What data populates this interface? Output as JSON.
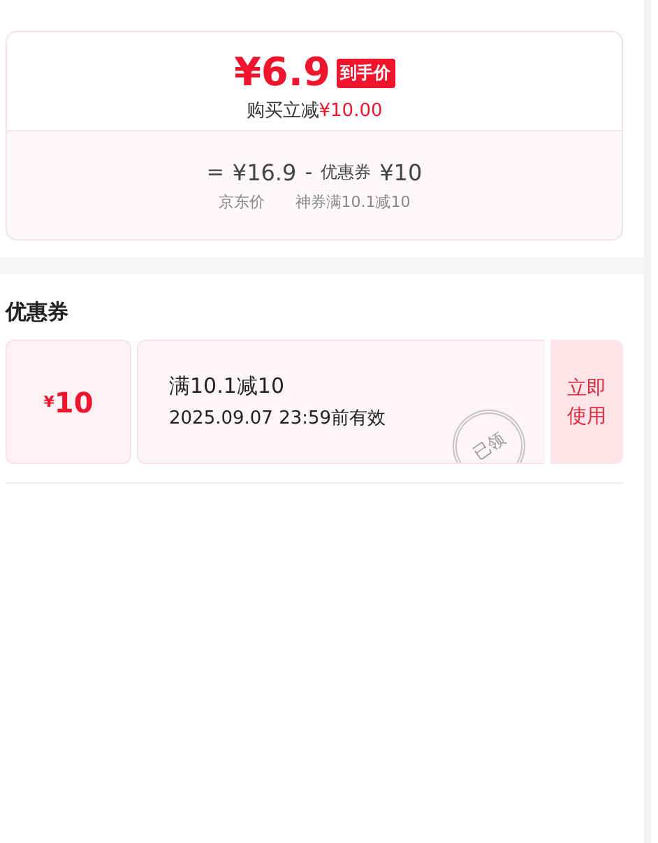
{
  "price_card": {
    "final_price": "¥6.9",
    "final_badge": "到手价",
    "saving_label": "购买立减",
    "saving_amount": "¥10.00",
    "equals": "=",
    "base_price": "¥16.9",
    "minus": "-",
    "coupon_label": "优惠券",
    "coupon_amount": "¥10",
    "base_caption": "京东价",
    "coupon_caption": "神券满10.1减10"
  },
  "coupons_section": {
    "title": "优惠券",
    "coupons": [
      {
        "currency": "¥",
        "amount": "10",
        "condition": "满10.1减10",
        "validity": "2025.09.07 23:59前有效",
        "stamp": "已领",
        "action": "立即使用"
      }
    ]
  }
}
